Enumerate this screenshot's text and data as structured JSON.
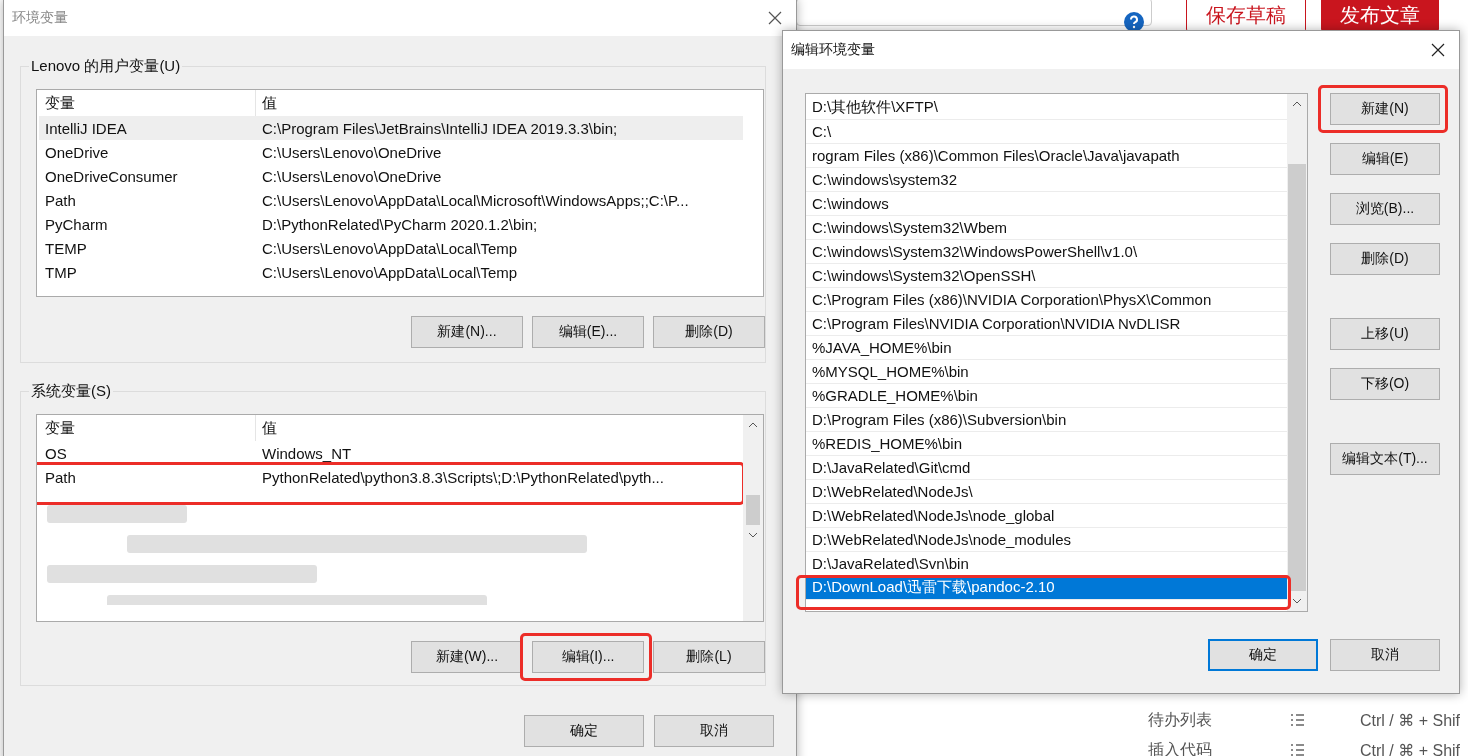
{
  "background_page": {
    "header_buttons": [
      {
        "label": "保存草稿",
        "kind": "outline"
      },
      {
        "label": "发布文章",
        "kind": "filled"
      }
    ],
    "shortcuts": [
      {
        "label": "待办列表",
        "keys": "Ctrl / ⌘ + Shif"
      },
      {
        "label": "插入代码",
        "keys": "Ctrl / ⌘ + Shif"
      }
    ]
  },
  "env_dialog": {
    "title": "环境变量",
    "user_group": {
      "title": "Lenovo 的用户变量(U)",
      "columns": [
        "变量",
        "值"
      ],
      "rows": [
        {
          "name": "IntelliJ IDEA",
          "value": "C:\\Program Files\\JetBrains\\IntelliJ IDEA 2019.3.3\\bin;",
          "selected": true,
          "highlighted": false
        },
        {
          "name": "OneDrive",
          "value": "C:\\Users\\Lenovo\\OneDrive",
          "selected": false,
          "highlighted": false
        },
        {
          "name": "OneDriveConsumer",
          "value": "C:\\Users\\Lenovo\\OneDrive",
          "selected": false,
          "highlighted": false
        },
        {
          "name": "Path",
          "value": "C:\\Users\\Lenovo\\AppData\\Local\\Microsoft\\WindowsApps;;C:\\P...",
          "selected": false,
          "highlighted": false
        },
        {
          "name": "PyCharm",
          "value": "D:\\PythonRelated\\PyCharm 2020.1.2\\bin;",
          "selected": false,
          "highlighted": false
        },
        {
          "name": "TEMP",
          "value": "C:\\Users\\Lenovo\\AppData\\Local\\Temp",
          "selected": false,
          "highlighted": false
        },
        {
          "name": "TMP",
          "value": "C:\\Users\\Lenovo\\AppData\\Local\\Temp",
          "selected": false,
          "highlighted": false
        }
      ],
      "buttons": [
        {
          "label": "新建(N)...",
          "highlighted": false
        },
        {
          "label": "编辑(E)...",
          "highlighted": false
        },
        {
          "label": "删除(D)",
          "highlighted": false
        }
      ]
    },
    "system_group": {
      "title": "系统变量(S)",
      "columns": [
        "变量",
        "值"
      ],
      "rows": [
        {
          "name": "OS",
          "value": "Windows_NT",
          "selected": false,
          "highlighted": false
        },
        {
          "name": "Path",
          "value": "PythonRelated\\python3.8.3\\Scripts\\;D:\\PythonRelated\\pyth...",
          "selected": false,
          "highlighted": true
        }
      ],
      "buttons": [
        {
          "label": "新建(W)...",
          "highlighted": false
        },
        {
          "label": "编辑(I)...",
          "highlighted": true
        },
        {
          "label": "删除(L)",
          "highlighted": false
        }
      ]
    },
    "buttons": [
      {
        "label": "确定"
      },
      {
        "label": "取消"
      }
    ]
  },
  "edit_dialog": {
    "title": "编辑环境变量",
    "entries": [
      {
        "path": "D:\\其他软件\\XFTP\\",
        "selected": false,
        "highlighted": false
      },
      {
        "path": "C:\\",
        "selected": false,
        "highlighted": false
      },
      {
        "path": "rogram Files (x86)\\Common Files\\Oracle\\Java\\javapath",
        "selected": false,
        "highlighted": false
      },
      {
        "path": "C:\\windows\\system32",
        "selected": false,
        "highlighted": false
      },
      {
        "path": "C:\\windows",
        "selected": false,
        "highlighted": false
      },
      {
        "path": "C:\\windows\\System32\\Wbem",
        "selected": false,
        "highlighted": false
      },
      {
        "path": "C:\\windows\\System32\\WindowsPowerShell\\v1.0\\",
        "selected": false,
        "highlighted": false
      },
      {
        "path": "C:\\windows\\System32\\OpenSSH\\",
        "selected": false,
        "highlighted": false
      },
      {
        "path": "C:\\Program Files (x86)\\NVIDIA Corporation\\PhysX\\Common",
        "selected": false,
        "highlighted": false
      },
      {
        "path": "C:\\Program Files\\NVIDIA Corporation\\NVIDIA NvDLISR",
        "selected": false,
        "highlighted": false
      },
      {
        "path": "%JAVA_HOME%\\bin",
        "selected": false,
        "highlighted": false
      },
      {
        "path": "%MYSQL_HOME%\\bin",
        "selected": false,
        "highlighted": false
      },
      {
        "path": "%GRADLE_HOME%\\bin",
        "selected": false,
        "highlighted": false
      },
      {
        "path": "D:\\Program Files (x86)\\Subversion\\bin",
        "selected": false,
        "highlighted": false
      },
      {
        "path": "%REDIS_HOME%\\bin",
        "selected": false,
        "highlighted": false
      },
      {
        "path": "D:\\JavaRelated\\Git\\cmd",
        "selected": false,
        "highlighted": false
      },
      {
        "path": "D:\\WebRelated\\NodeJs\\",
        "selected": false,
        "highlighted": false
      },
      {
        "path": "D:\\WebRelated\\NodeJs\\node_global",
        "selected": false,
        "highlighted": false
      },
      {
        "path": "D:\\WebRelated\\NodeJs\\node_modules",
        "selected": false,
        "highlighted": false
      },
      {
        "path": "D:\\JavaRelated\\Svn\\bin",
        "selected": false,
        "highlighted": false
      },
      {
        "path": "D:\\DownLoad\\迅雷下载\\pandoc-2.10",
        "selected": true,
        "highlighted": true
      }
    ],
    "buttons": [
      {
        "label": "新建(N)",
        "highlighted": true
      },
      {
        "label": "编辑(E)",
        "highlighted": false
      },
      {
        "label": "浏览(B)...",
        "highlighted": false
      },
      {
        "label": "删除(D)",
        "highlighted": false
      },
      {
        "label": "上移(U)",
        "highlighted": false
      },
      {
        "label": "下移(O)",
        "highlighted": false
      },
      {
        "label": "编辑文本(T)...",
        "highlighted": false
      }
    ],
    "footer_buttons": [
      {
        "label": "确定",
        "default": true
      },
      {
        "label": "取消",
        "default": false
      }
    ]
  }
}
